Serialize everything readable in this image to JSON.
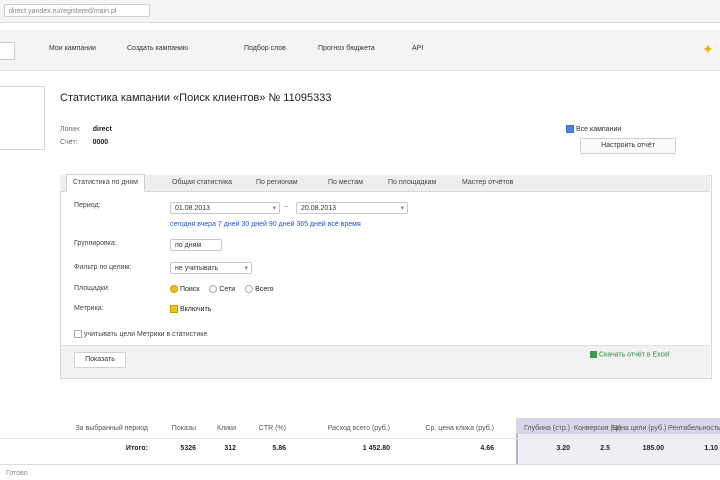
{
  "browser": {
    "url": "direct.yandex.ru/registered/main.pl"
  },
  "nav": {
    "items": [
      "Мои кампании",
      "Создать кампанию",
      "Подбор слов",
      "Прогноз бюджета",
      "API"
    ]
  },
  "page": {
    "title": "Статистика кампании «Поиск клиентов» № 11095333",
    "info": [
      {
        "label": "Логин:",
        "value": "direct"
      },
      {
        "label": "Счёт:",
        "value": "0000"
      }
    ],
    "side_checkbox": "Все кампании",
    "side_button": "Настроить отчёт"
  },
  "tabs": [
    "Статистика по дням",
    "Общая статистика",
    "По регионам",
    "По местам",
    "По площадкам",
    "Мастер отчётов"
  ],
  "form": {
    "period_label": "Период:",
    "date_from": "01.08.2013",
    "date_to": "20.08.2013",
    "period_links": [
      "сегодня",
      "вчера",
      "7 дней",
      "30 дней",
      "90 дней",
      "365 дней",
      "всё время"
    ],
    "group_label": "Группировка:",
    "group_value": "по дням",
    "filter_label": "Фильтр по целям:",
    "filter_value": "не учитывать",
    "show_label": "Площадки:",
    "show_options": [
      "Поиск",
      "Сети",
      "Всего"
    ],
    "metric_label": "Метрика:",
    "metric_value": "Включить",
    "extra_checkbox": "учитывать цели Метрики в статистике",
    "submit": "Показать",
    "excel_link": "Скачать отчёт в Excel"
  },
  "table": {
    "headers": [
      "За выбранный период",
      "Показы",
      "Клики",
      "CTR (%)",
      "Расход всего (руб.)",
      "Ср. цена клика (руб.)",
      "Глубина (стр.)",
      "Конверсия (%)",
      "Цена цели (руб.)",
      "Рентабельность"
    ],
    "values": [
      "Итого:",
      "5326",
      "312",
      "5.86",
      "1 452.80",
      "4.66",
      "3.20",
      "2.5",
      "185.00",
      "1.10"
    ]
  },
  "status": {
    "text": "Готово"
  }
}
